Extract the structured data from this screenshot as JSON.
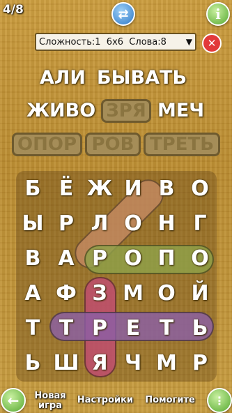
{
  "header": {
    "progress": "4/8",
    "swap_icon": "⇄",
    "info_icon": "i",
    "dropdown_value": "Сложность:1  6x6  Слова:8",
    "dropdown_arrow": "▼",
    "close_icon": "✕"
  },
  "words": {
    "remaining": [
      "АЛИ",
      "БЫВАТЬ",
      "ЖИВО",
      "МЕЧ"
    ],
    "found": [
      "ЗРЯ",
      "ОПОР",
      "РОВ",
      "ТРЕТЬ"
    ]
  },
  "grid": [
    [
      "Б",
      "Ё",
      "Ж",
      "И",
      "В",
      "О"
    ],
    [
      "Ы",
      "Р",
      "Л",
      "О",
      "Н",
      "Г"
    ],
    [
      "В",
      "А",
      "Р",
      "О",
      "П",
      "О"
    ],
    [
      "А",
      "Ф",
      "З",
      "М",
      "О",
      "Й"
    ],
    [
      "Т",
      "Т",
      "Р",
      "Е",
      "Т",
      "Ь"
    ],
    [
      "Ь",
      "Ш",
      "Я",
      "Ч",
      "М",
      "Р"
    ]
  ],
  "highlight_colors": {
    "rov": "#c48a63",
    "opor": "#8fa34a",
    "zrya": "#c24b73",
    "tret": "#8b5fa8"
  },
  "footer": {
    "back_icon": "←",
    "new_game": "Новая игра",
    "settings": "Настройки",
    "help": "Помогите",
    "menu_icon": "⋮"
  }
}
